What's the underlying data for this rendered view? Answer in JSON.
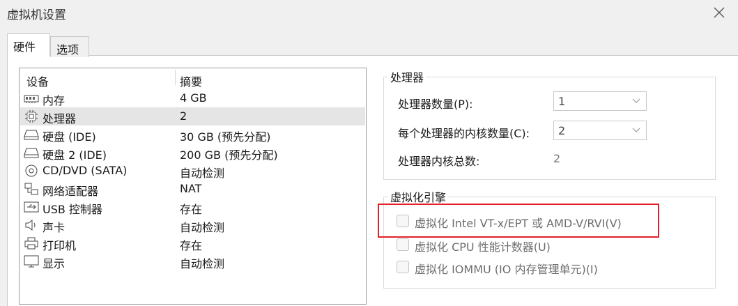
{
  "window": {
    "title": "虚拟机设置"
  },
  "tabs": [
    {
      "label": "硬件"
    },
    {
      "label": "选项"
    }
  ],
  "device_list": {
    "headers": [
      "设备",
      "摘要"
    ],
    "rows": [
      {
        "icon": "memory-icon",
        "name": "内存",
        "summary": "4 GB"
      },
      {
        "icon": "processor-icon",
        "name": "处理器",
        "summary": "2",
        "selected": true
      },
      {
        "icon": "hard-disk-icon",
        "name": "硬盘 (IDE)",
        "summary": "30 GB (预先分配)"
      },
      {
        "icon": "hard-disk-icon",
        "name": "硬盘 2 (IDE)",
        "summary": "200 GB (预先分配)"
      },
      {
        "icon": "cd-dvd-icon",
        "name": "CD/DVD (SATA)",
        "summary": "自动检测"
      },
      {
        "icon": "network-adapter-icon",
        "name": "网络适配器",
        "summary": "NAT"
      },
      {
        "icon": "usb-icon",
        "name": "USB 控制器",
        "summary": "存在"
      },
      {
        "icon": "speaker-icon",
        "name": "声卡",
        "summary": "自动检测"
      },
      {
        "icon": "printer-icon",
        "name": "打印机",
        "summary": "存在"
      },
      {
        "icon": "display-icon",
        "name": "显示",
        "summary": "自动检测"
      }
    ]
  },
  "processor": {
    "group_title": "处理器",
    "count_label": "处理器数量(P):",
    "count_value": "1",
    "cores_label": "每个处理器的内核数量(C):",
    "cores_value": "2",
    "total_label": "处理器内核总数:",
    "total_value": "2"
  },
  "virtualization": {
    "group_title": "虚拟化引擎",
    "options": [
      {
        "label": "虚拟化 Intel VT-x/EPT 或 AMD-V/RVI(V)",
        "checked": false,
        "enabled": false
      },
      {
        "label": "虚拟化 CPU 性能计数器(U)",
        "checked": false,
        "enabled": false
      },
      {
        "label": "虚拟化 IOMMU (IO 内存管理单元)(I)",
        "checked": false,
        "enabled": false
      }
    ]
  },
  "colors": {
    "highlight": "#e32027",
    "selected_row": "#e5e5e5",
    "window_bg": "#f0f0f0"
  }
}
